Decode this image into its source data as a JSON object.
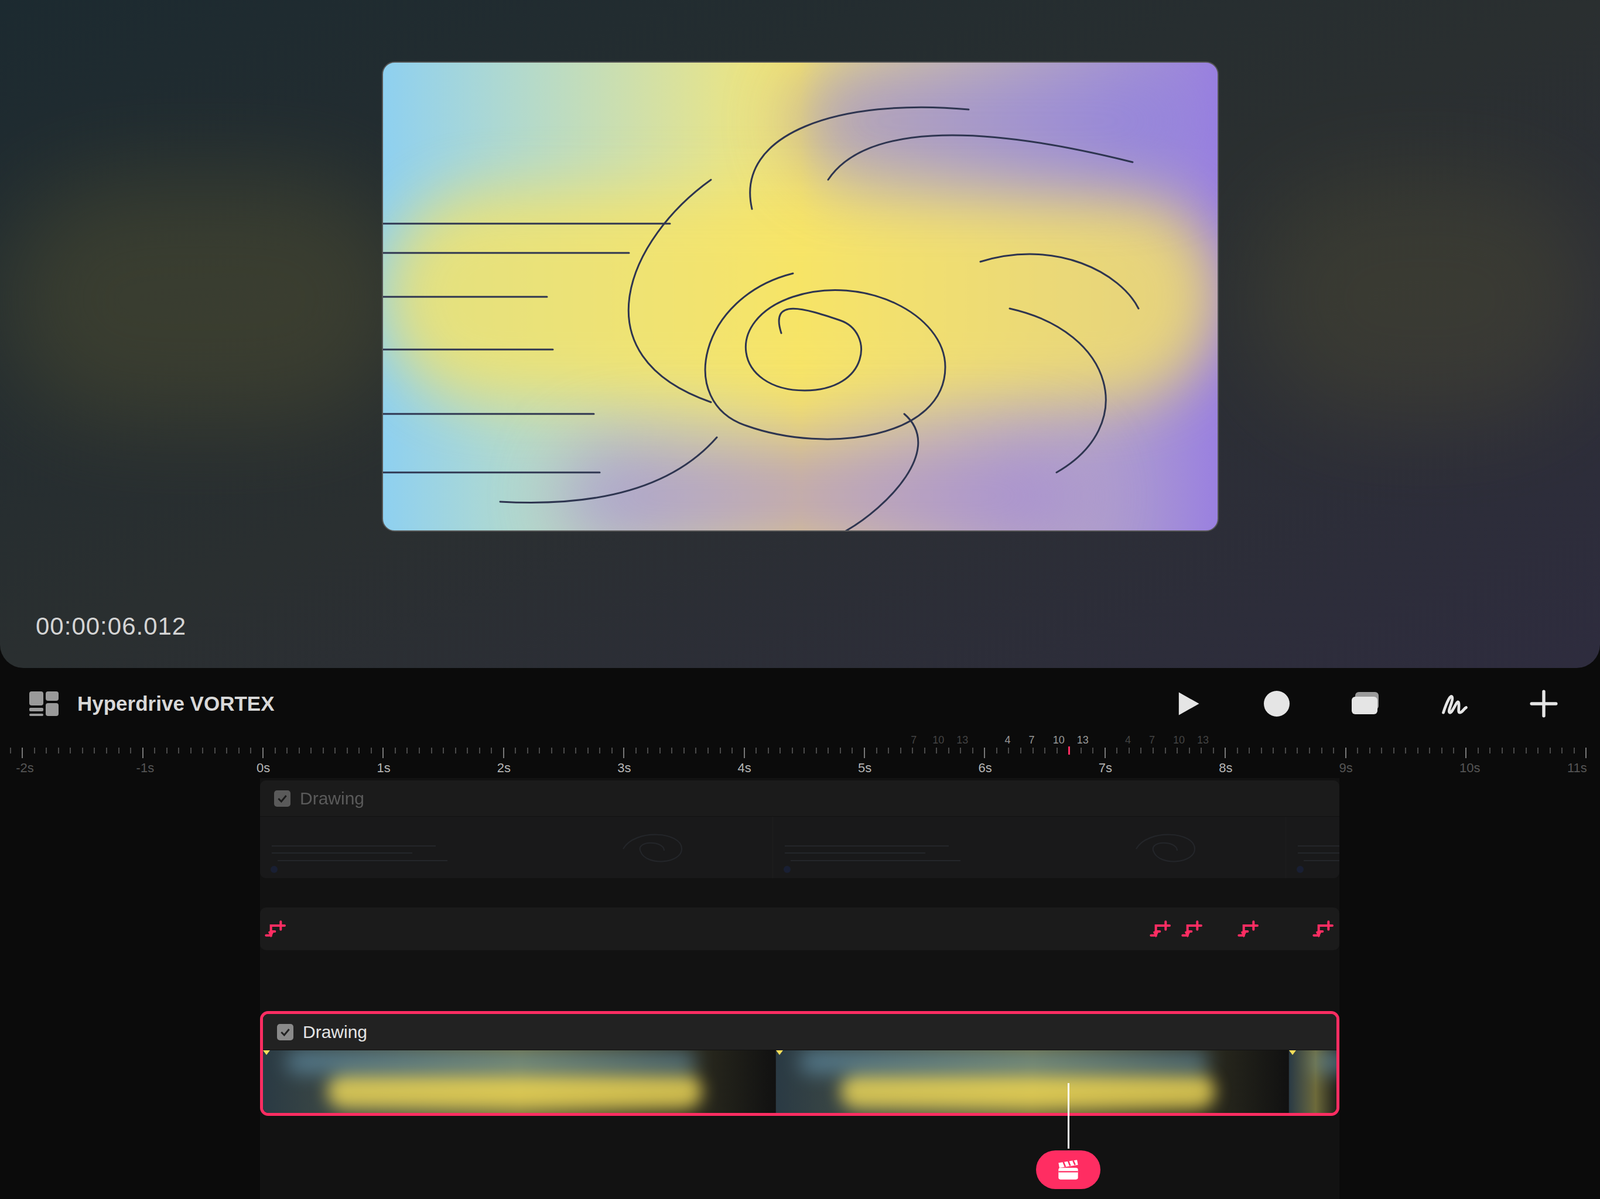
{
  "window": {
    "title": "Hyperdrive VORTEX"
  },
  "preview": {
    "timecode": "00:00:06.012"
  },
  "toolbar": {
    "buttons": [
      "play",
      "record",
      "layers",
      "draw",
      "add"
    ]
  },
  "ruler": {
    "labels": [
      {
        "text": "-2s",
        "time": -2,
        "dimmed": true
      },
      {
        "text": "-1s",
        "time": -1,
        "dimmed": true
      },
      {
        "text": "0s",
        "time": 0,
        "dimmed": false
      },
      {
        "text": "1s",
        "time": 1,
        "dimmed": false
      },
      {
        "text": "2s",
        "time": 2,
        "dimmed": false
      },
      {
        "text": "3s",
        "time": 3,
        "dimmed": false
      },
      {
        "text": "4s",
        "time": 4,
        "dimmed": false
      },
      {
        "text": "5s",
        "time": 5,
        "dimmed": false
      },
      {
        "text": "6s",
        "time": 6,
        "dimmed": false
      },
      {
        "text": "7s",
        "time": 7,
        "dimmed": false
      },
      {
        "text": "8s",
        "time": 8,
        "dimmed": false
      },
      {
        "text": "9s",
        "time": 9,
        "dimmed": true
      },
      {
        "text": "10s",
        "time": 10,
        "dimmed": true
      },
      {
        "text": "11s",
        "time": 11,
        "dimmed": true
      }
    ],
    "frame_marks": [
      {
        "text": "7",
        "time": 5.42,
        "bright": false
      },
      {
        "text": "10",
        "time": 5.6,
        "bright": false
      },
      {
        "text": "13",
        "time": 5.8,
        "bright": false
      },
      {
        "text": "4",
        "time": 6.2,
        "bright": true
      },
      {
        "text": "7",
        "time": 6.4,
        "bright": true
      },
      {
        "text": "10",
        "time": 6.6,
        "bright": true
      },
      {
        "text": "13",
        "time": 6.8,
        "bright": true
      },
      {
        "text": "4",
        "time": 7.2,
        "bright": false
      },
      {
        "text": "7",
        "time": 7.4,
        "bright": false
      },
      {
        "text": "10",
        "time": 7.6,
        "bright": false
      },
      {
        "text": "13",
        "time": 7.8,
        "bright": false
      }
    ]
  },
  "playhead": {
    "time": 6.7
  },
  "tracks": [
    {
      "kind": "track",
      "name": "Drawing",
      "checked": true,
      "dimmed": true,
      "selected": false,
      "thumbnail": "sketch"
    },
    {
      "kind": "keyframes",
      "keyframes": [
        0.11,
        7.47,
        7.73,
        8.2,
        8.82
      ]
    },
    {
      "kind": "track",
      "name": "Drawing",
      "checked": true,
      "dimmed": false,
      "selected": true,
      "thumbnail": "paint"
    }
  ]
}
